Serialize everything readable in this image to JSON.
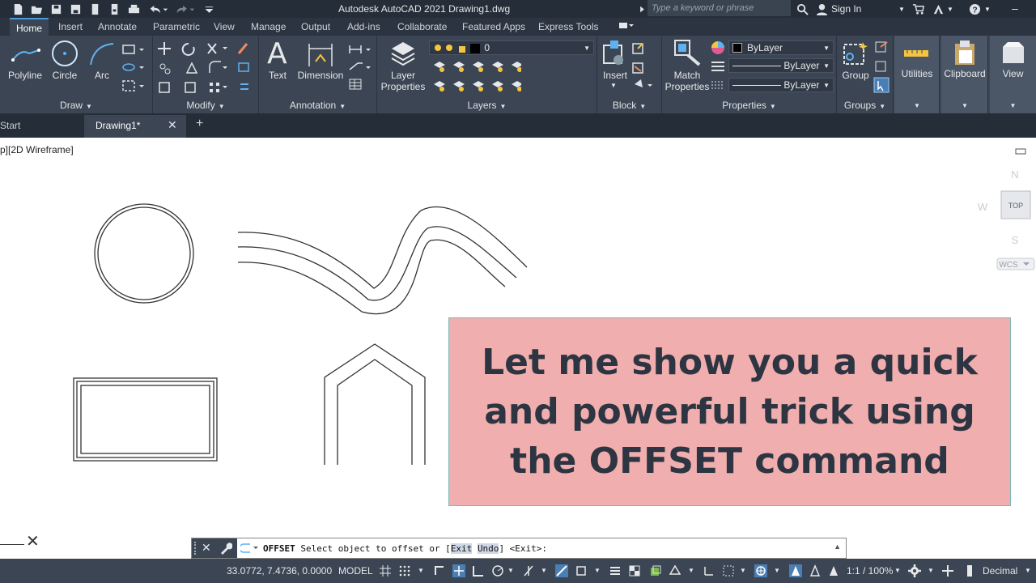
{
  "title": "Autodesk AutoCAD 2021   Drawing1.dwg",
  "search_placeholder": "Type a keyword or phrase",
  "sign_in": "Sign In",
  "tabs": [
    "Home",
    "Insert",
    "Annotate",
    "Parametric",
    "View",
    "Manage",
    "Output",
    "Add-ins",
    "Collaborate",
    "Featured Apps",
    "Express Tools"
  ],
  "ribbon": {
    "draw": {
      "label": "Draw",
      "polyline": "Polyline",
      "circle": "Circle",
      "arc": "Arc"
    },
    "modify": {
      "label": "Modify"
    },
    "annotation": {
      "label": "Annotation",
      "text": "Text",
      "dimension": "Dimension"
    },
    "layers": {
      "label": "Layers",
      "layer_properties_1": "Layer",
      "layer_properties_2": "Properties",
      "current_layer": "0"
    },
    "block": {
      "label": "Block",
      "insert": "Insert"
    },
    "properties": {
      "label": "Properties",
      "match_1": "Match",
      "match_2": "Properties",
      "color": "ByLayer",
      "linetype": "ByLayer",
      "lineweight": "ByLayer"
    },
    "groups": {
      "label": "Groups",
      "group": "Group"
    },
    "utilities": "Utilities",
    "clipboard": "Clipboard",
    "view": "View"
  },
  "doc_tabs": {
    "start": "Start",
    "drawing": "Drawing1*"
  },
  "viewport_label": "p][2D Wireframe]",
  "viewcube": {
    "n": "N",
    "w": "W",
    "s": "S",
    "top": "TOP",
    "wcs": "WCS"
  },
  "overlay_text": "Let me show you a quick and powerful trick using the OFFSET command",
  "command": {
    "name": "OFFSET",
    "prompt": "Select object to offset or [",
    "opt1": "Exit",
    "opt2": "Undo",
    "tail": "] <Exit>:"
  },
  "status": {
    "coords": "33.0772, 7.4736, 0.0000",
    "model": "MODEL",
    "scale": "1:1 / 100%",
    "units": "Decimal"
  }
}
